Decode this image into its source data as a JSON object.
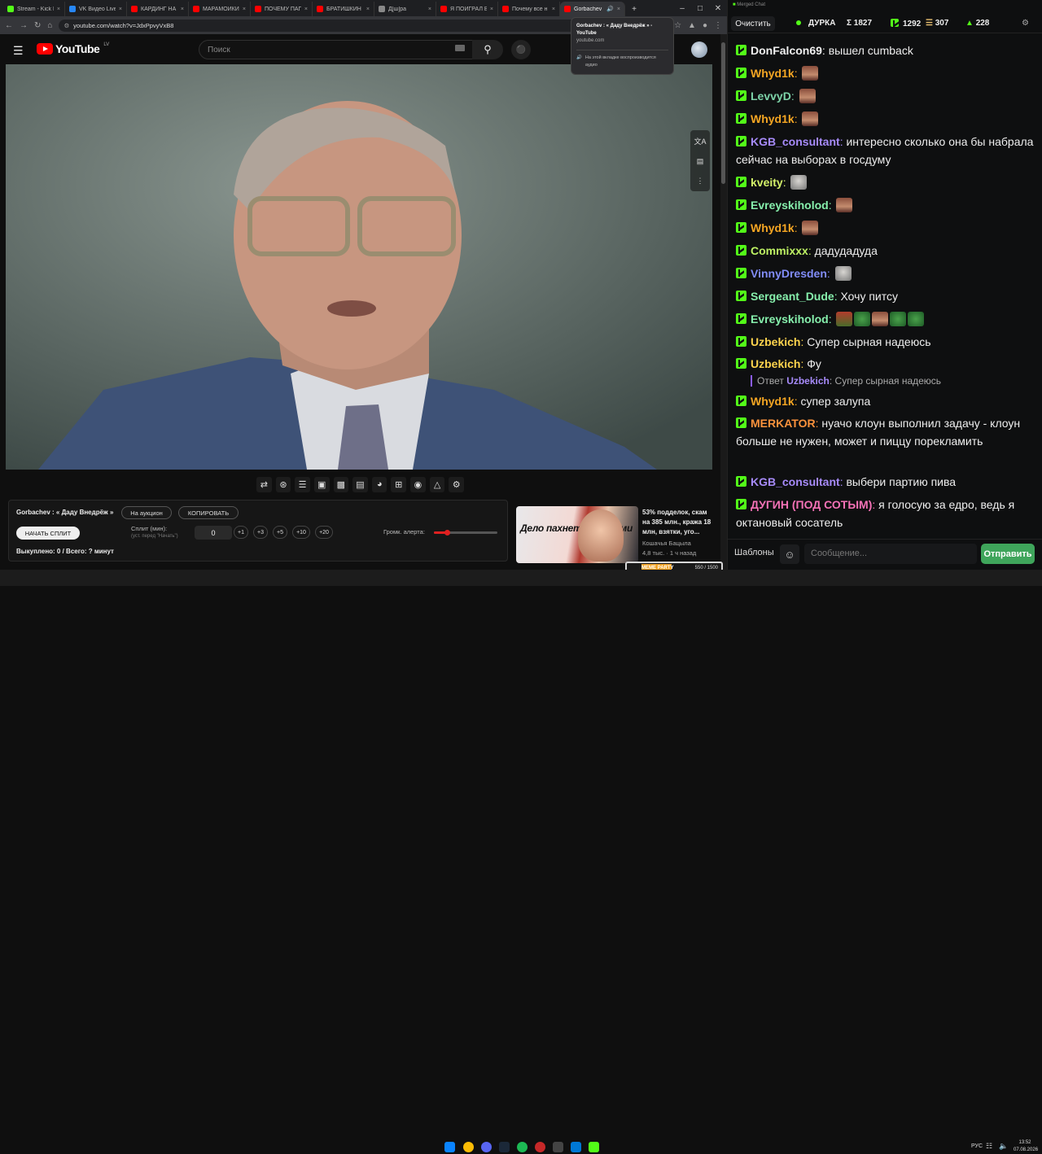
{
  "browser": {
    "tabs": [
      {
        "title": "Stream - Kick D",
        "color": "#53fc18"
      },
      {
        "title": "VK Видео Live",
        "color": "#2787f5"
      },
      {
        "title": "КАРДИНГ НА",
        "color": "#ff0000"
      },
      {
        "title": "МАРАМОЙКИ",
        "color": "#ff0000"
      },
      {
        "title": "ПОЧЕМУ ПАП",
        "color": "#ff0000"
      },
      {
        "title": "БРАТИШКИН",
        "color": "#ff0000"
      },
      {
        "title": "Д[ш]ра",
        "color": "#888888"
      },
      {
        "title": "Я ПОИГРАЛ В",
        "color": "#ff0000"
      },
      {
        "title": "Почему все н",
        "color": "#ff0000"
      },
      {
        "title": "Gorbachev",
        "color": "#ff0000"
      }
    ],
    "url": "youtube.com/watch?v=JdxPpvyVxB8",
    "tooltip": {
      "title": "Gorbachev : « Даду Внедрёж » - YouTube",
      "domain": "youtube.com",
      "audio": "На этой вкладке воспроизводится аудио"
    }
  },
  "youtube": {
    "logo_text": "YouTube",
    "logo_region": "LV",
    "search_placeholder": "Поиск"
  },
  "panel": {
    "video_title": "Gorbachev : « Даду Внедрёж »",
    "auction_label": "На аукцион",
    "copy_label": "КОПИРОВАТЬ",
    "start_split_label": "НАЧАТЬ СПЛИТ",
    "split_label": "Сплит (мин):",
    "split_hint": "(уст. перед \"Начать\")",
    "split_value": "0",
    "increments": [
      "+1",
      "+3",
      "+5",
      "+10",
      "+20"
    ],
    "alert_volume_label": "Громк. алерта:",
    "alert_volume": 0.2,
    "bought_text": "Выкуплено: 0 / Всего: ? минут"
  },
  "recommendation": {
    "thumb_caption": "Дело пахнет писюпами",
    "title": "53% подделок, скам на 385 млн., кража 18 млн, взятки, уго...",
    "channel": "Кошачья Бацыла",
    "meta": "4,8 тыс. · 1 ч назад"
  },
  "meme_party": {
    "label": "MEME PARTY",
    "progress_text": "550 / 1500",
    "progress": 0.367
  },
  "chat": {
    "window_title": "Merged Chat",
    "clear_label": "Очистить",
    "channel": "ДУРКА",
    "stats": [
      {
        "icon": "sigma",
        "value": "1827"
      },
      {
        "icon": "kick",
        "value": "1292"
      },
      {
        "icon": "twitch",
        "value": "307"
      },
      {
        "icon": "vk",
        "value": "228"
      }
    ],
    "messages": [
      {
        "user": "DonFalcon69",
        "color": "#f0f0f0",
        "text": "вышел cumback"
      },
      {
        "user": "Whyd1k",
        "color": "#f5a623",
        "emotes": [
          "face"
        ]
      },
      {
        "user": "LevvyD",
        "color": "#7dd3a8",
        "emotes": [
          "face"
        ]
      },
      {
        "user": "Whyd1k",
        "color": "#f5a623",
        "emotes": [
          "face"
        ]
      },
      {
        "user": "KGB_consultant",
        "color": "#a78bfa",
        "text": "интересно сколько она бы набрала сейчас на выборах в госдуму"
      },
      {
        "user": "kveity",
        "color": "#d4f26a",
        "emotes": [
          "cat"
        ]
      },
      {
        "user": "Evreyskiholod",
        "color": "#86efac",
        "emotes": [
          "face"
        ]
      },
      {
        "user": "Whyd1k",
        "color": "#f5a623",
        "emotes": [
          "face"
        ]
      },
      {
        "user": "Commixxx",
        "color": "#bef264",
        "text": "дадудадуда"
      },
      {
        "user": "VinnyDresden",
        "color": "#818cf8",
        "emotes": [
          "cat"
        ]
      },
      {
        "user": "Sergeant_Dude",
        "color": "#86efac",
        "text": "Хочу питсу"
      },
      {
        "user": "Evreyskiholod",
        "color": "#86efac",
        "emotes": [
          "pat",
          "frog",
          "face",
          "frog",
          "frog"
        ]
      },
      {
        "user": "Uzbekich",
        "color": "#fcd34d",
        "text": "Супер сырная надеюсь"
      },
      {
        "user": "Uzbekich",
        "color": "#fcd34d",
        "text": "Фу"
      },
      {
        "user": "Whyd1k",
        "color": "#f5a623",
        "text": "супер залупа"
      },
      {
        "user": "MERKATOR",
        "color": "#fb923c",
        "text": "нуачо клоун выполнил задачу - клоун больше не нужен, может и пиццу порекламить"
      },
      {
        "user": "KGB_consultant",
        "color": "#a78bfa",
        "text": "выбери партию пива"
      },
      {
        "user": "ДУГИН (ПОД СОТЫМ)",
        "color": "#f472b6",
        "text": "я голосую за едро, ведь я октановый сосатель"
      }
    ],
    "reply": {
      "prefix": "Ответ",
      "user": "Uzbekich",
      "user_color": "#a78bfa",
      "text": "Супер сырная надеюсь"
    },
    "templates_label": "Шаблоны",
    "message_placeholder": "Сообщение...",
    "send_label": "Отправить"
  },
  "taskbar": {
    "lang": "РУС",
    "time": "13:52",
    "date": "07.08.2026"
  }
}
